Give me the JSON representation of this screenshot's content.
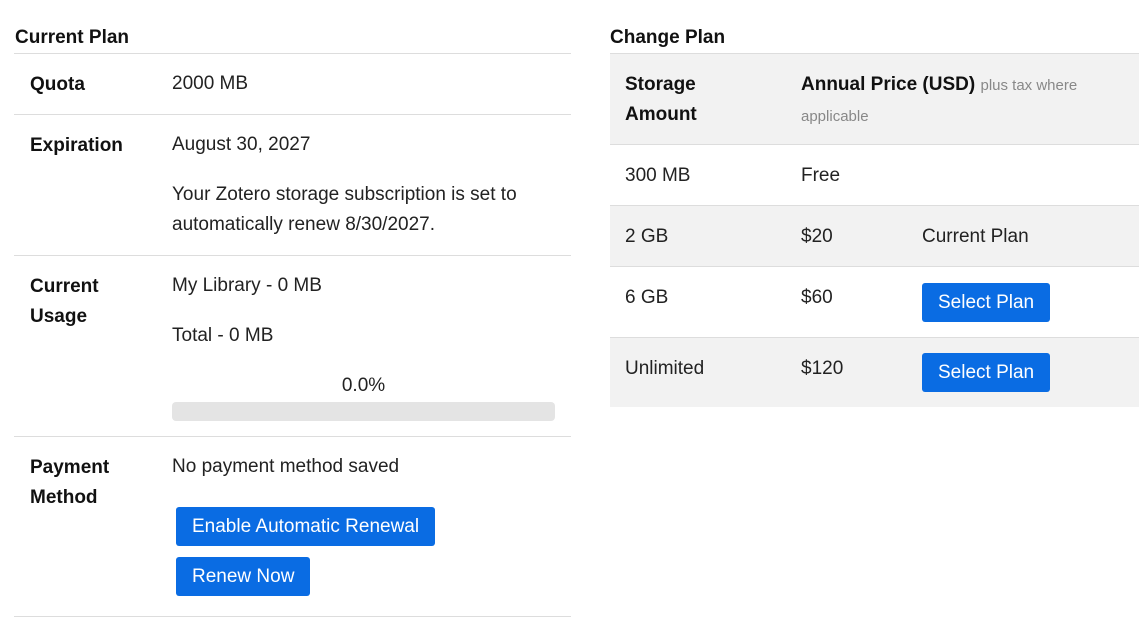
{
  "current_plan": {
    "title": "Current Plan",
    "quota": {
      "label": "Quota",
      "value": "2000 MB"
    },
    "expiration": {
      "label": "Expiration",
      "value": "August 30, 2027",
      "note": "Your Zotero storage subscription is set to automatically renew 8/30/2027."
    },
    "usage": {
      "label": "Current Usage",
      "library": "My Library - 0 MB",
      "total": "Total - 0 MB",
      "percent_text": "0.0%",
      "percent_value": 0
    },
    "payment": {
      "label": "Payment Method",
      "value": "No payment method saved",
      "enable_renewal_button": "Enable Automatic Renewal",
      "renew_now_button": "Renew Now"
    }
  },
  "change_plan": {
    "title": "Change Plan",
    "headers": {
      "storage": "Storage Amount",
      "price": "Annual Price (USD)",
      "price_note": "plus tax where applicable"
    },
    "rows": [
      {
        "storage": "300 MB",
        "price": "Free",
        "action": ""
      },
      {
        "storage": "2 GB",
        "price": "$20",
        "action": "Current Plan"
      },
      {
        "storage": "6 GB",
        "price": "$60",
        "action": "Select Plan"
      },
      {
        "storage": "Unlimited",
        "price": "$120",
        "action": "Select Plan"
      }
    ]
  },
  "colors": {
    "accent": "#0a6ce3",
    "row_shade": "#f2f2f2",
    "divider": "#dddddd",
    "progress_track": "#e4e4e4"
  }
}
